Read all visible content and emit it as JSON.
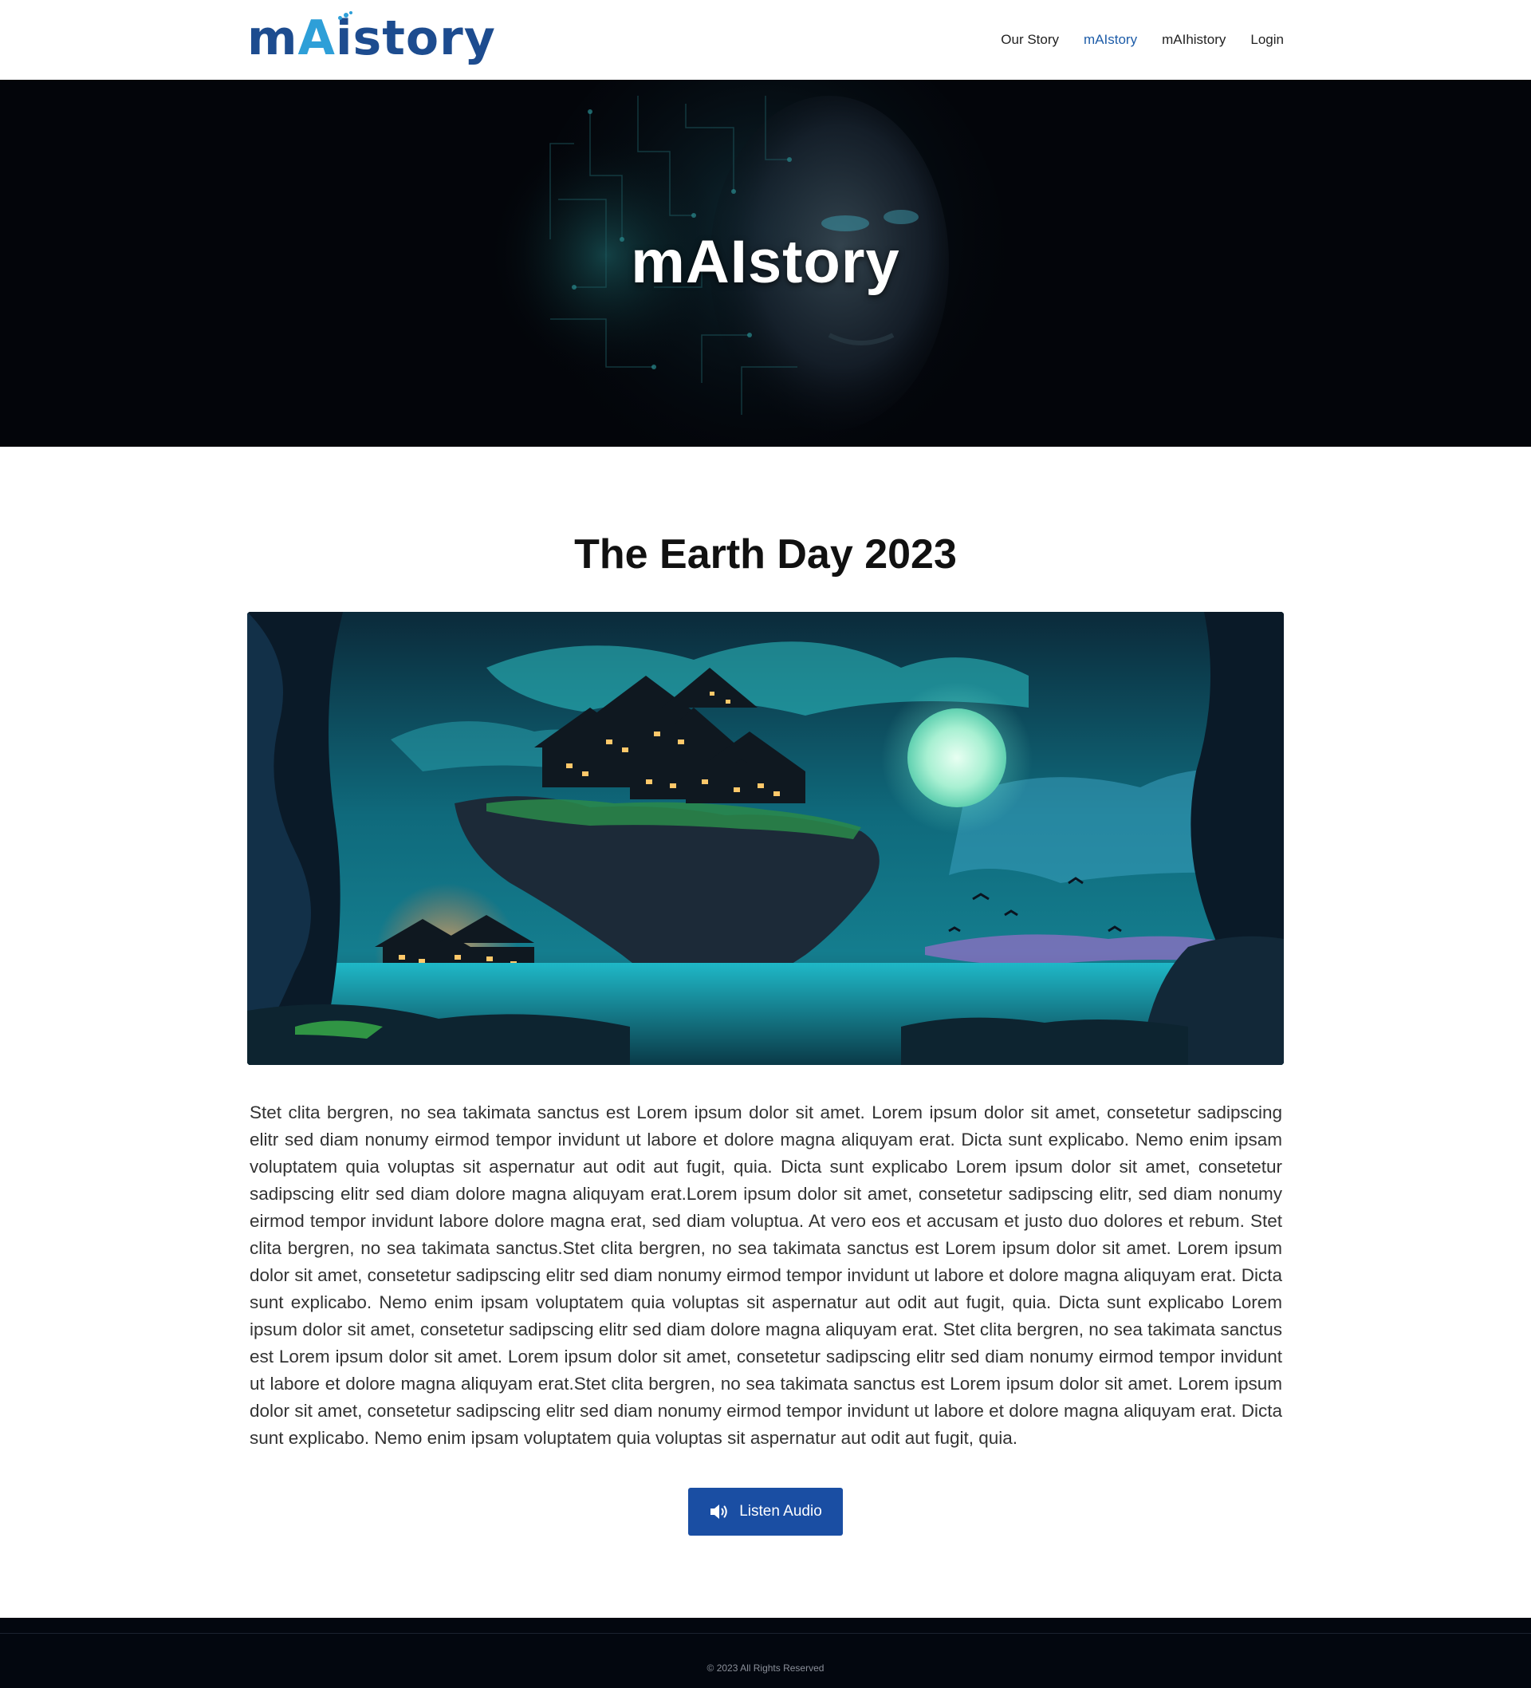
{
  "header": {
    "logo_text_before": "m",
    "logo_text_ai": "A",
    "logo_text_after": "istory",
    "nav": [
      {
        "label": "Our Story",
        "active": false
      },
      {
        "label": "mAIstory",
        "active": true
      },
      {
        "label": "mAIhistory",
        "active": false
      },
      {
        "label": "Login",
        "active": false
      }
    ]
  },
  "hero": {
    "title": "mAIstory"
  },
  "article": {
    "title": "The Earth Day 2023",
    "body": "Stet clita bergren, no sea takimata sanctus est Lorem ipsum dolor sit amet. Lorem ipsum dolor sit amet, consetetur sadipscing elitr sed diam nonumy eirmod tempor invidunt ut labore et dolore magna aliquyam erat. Dicta sunt explicabo. Nemo enim ipsam voluptatem quia voluptas sit aspernatur aut odit aut fugit, quia. Dicta sunt explicabo Lorem ipsum dolor sit amet, consetetur sadipscing elitr sed diam dolore magna aliquyam erat.Lorem ipsum dolor sit amet, consetetur sadipscing elitr, sed diam nonumy eirmod tempor invidunt labore dolore magna erat, sed diam voluptua. At vero eos et accusam et justo duo dolores et rebum. Stet clita bergren, no sea takimata sanctus.Stet clita bergren, no sea takimata sanctus est Lorem ipsum dolor sit amet. Lorem ipsum dolor sit amet, consetetur sadipscing elitr sed diam nonumy eirmod tempor invidunt ut labore et dolore magna aliquyam erat. Dicta sunt explicabo. Nemo enim ipsam voluptatem quia voluptas sit aspernatur aut odit aut fugit, quia. Dicta sunt explicabo Lorem ipsum dolor sit amet, consetetur sadipscing elitr sed diam dolore magna aliquyam erat. Stet clita bergren, no sea takimata sanctus est Lorem ipsum dolor sit amet. Lorem ipsum dolor sit amet, consetetur sadipscing elitr sed diam nonumy eirmod tempor invidunt ut labore et dolore magna aliquyam erat.Stet clita bergren, no sea takimata sanctus est Lorem ipsum dolor sit amet. Lorem ipsum dolor sit amet, consetetur sadipscing elitr sed diam nonumy eirmod tempor invidunt ut labore et dolore magna aliquyam erat. Dicta sunt explicabo. Nemo enim ipsam voluptatem quia voluptas sit aspernatur aut odit aut fugit, quia.",
    "listen_label": "Listen Audio",
    "listen_icon": "speaker-icon"
  },
  "footer": {
    "copyright": "© 2023 All Rights Reserved"
  },
  "colors": {
    "brand_blue": "#1d4c8f",
    "brand_cyan": "#2e9fd8",
    "nav_active": "#1d5ca8",
    "button_bg": "#1a4ea3",
    "hero_bg": "#03050a",
    "footer_bg": "#03070f"
  }
}
